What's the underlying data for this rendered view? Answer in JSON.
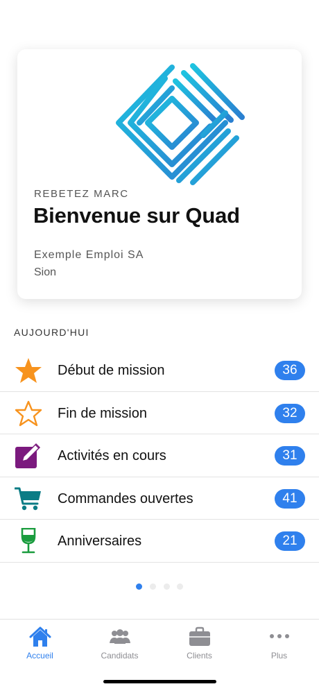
{
  "card": {
    "user_name": "REBETEZ MARC",
    "welcome": "Bienvenue sur Quad",
    "company": "Exemple Emploi SA",
    "city": "Sion",
    "logo_color": "#2a9fd6"
  },
  "today": {
    "title": "AUJOURD'HUI",
    "items": [
      {
        "label": "Début de mission",
        "count": "36",
        "icon": "star-filled-icon",
        "color": "#f7931e"
      },
      {
        "label": "Fin de mission",
        "count": "32",
        "icon": "star-outline-icon",
        "color": "#f7931e"
      },
      {
        "label": "Activités en cours",
        "count": "31",
        "icon": "edit-icon",
        "color": "#7b1a7e"
      },
      {
        "label": "Commandes ouvertes",
        "count": "41",
        "icon": "cart-icon",
        "color": "#0b7c85"
      },
      {
        "label": "Anniversaires",
        "count": "21",
        "icon": "wine-glass-icon",
        "color": "#1a9c3e"
      }
    ]
  },
  "pager": {
    "pages": 4,
    "current": 1
  },
  "tabs": [
    {
      "label": "Accueil",
      "icon": "home-icon",
      "active": true
    },
    {
      "label": "Candidats",
      "icon": "people-icon",
      "active": false
    },
    {
      "label": "Clients",
      "icon": "briefcase-icon",
      "active": false
    },
    {
      "label": "Plus",
      "icon": "more-icon",
      "active": false
    }
  ],
  "colors": {
    "accent": "#2f80ed",
    "inactive": "#8e8e93"
  }
}
